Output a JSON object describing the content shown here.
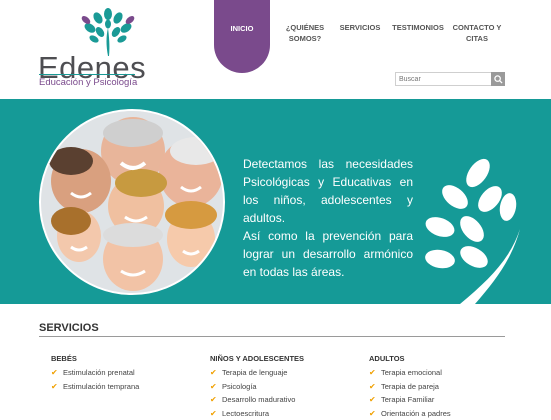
{
  "brand": {
    "name": "Edenes",
    "tagline": "Educación y Psicología",
    "colors": {
      "teal": "#159a97",
      "purple": "#7a4a8c"
    }
  },
  "nav": {
    "items": [
      {
        "label": "INICIO",
        "active": true
      },
      {
        "label": "¿QUIÉNES SOMOS?",
        "active": false
      },
      {
        "label": "SERVICIOS",
        "active": false
      },
      {
        "label": "TESTIMONIOS",
        "active": false
      },
      {
        "label": "CONTACTO Y CITAS",
        "active": false
      }
    ]
  },
  "search": {
    "placeholder": "Buscar",
    "icon": "search-icon"
  },
  "hero": {
    "text_1": "Detectamos las necesidades Psicológicas y Educativas en los niños, adolescentes y adultos.",
    "text_2": "Así como la prevención para lograr un desarrollo armónico en todas las áreas."
  },
  "services": {
    "title": "SERVICIOS",
    "columns": [
      {
        "title": "BEBÉS",
        "items": [
          "Estimulación prenatal",
          "Estimulación temprana"
        ]
      },
      {
        "title": "NIÑOS Y ADOLESCENTES",
        "items": [
          "Terapia de lenguaje",
          "Psicología",
          "Desarrollo madurativo",
          "Lectoescritura"
        ]
      },
      {
        "title": "ADULTOS",
        "items": [
          "Terapia emocional",
          "Terapia de pareja",
          "Terapia Familiar",
          "Orientación a padres"
        ]
      }
    ]
  }
}
